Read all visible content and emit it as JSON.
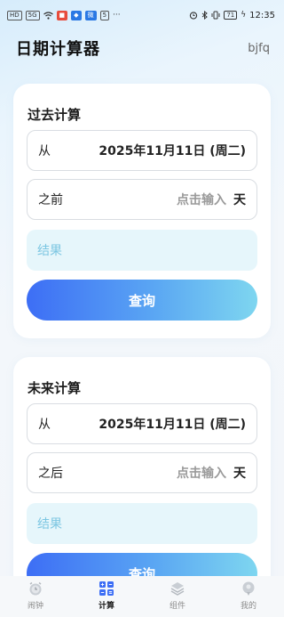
{
  "status_bar": {
    "left_chips": [
      "HD",
      "5G"
    ],
    "app_badges": [
      "微",
      "5"
    ],
    "battery": "71",
    "time": "12:35"
  },
  "header": {
    "title": "日期计算器",
    "right_link": "bjfq"
  },
  "past": {
    "title": "过去计算",
    "from_label": "从",
    "from_value": "2025年11月11日 (周二)",
    "days_label": "之前",
    "days_placeholder": "点击输入",
    "days_unit": "天",
    "result_label": "结果",
    "button_label": "查询"
  },
  "future": {
    "title": "未来计算",
    "from_label": "从",
    "from_value": "2025年11月11日 (周二)",
    "days_label": "之后",
    "days_placeholder": "点击输入",
    "days_unit": "天",
    "result_label": "结果",
    "button_label": "查询"
  },
  "tabs": [
    {
      "label": "闹钟",
      "icon": "clock-icon",
      "active": false
    },
    {
      "label": "计算",
      "icon": "grid-calculator-icon",
      "active": true
    },
    {
      "label": "组件",
      "icon": "layers-icon",
      "active": false
    },
    {
      "label": "我的",
      "icon": "profile-icon",
      "active": false
    }
  ],
  "colors": {
    "accent_start": "#3d6ef5",
    "accent_end": "#7ed6f0",
    "result_bg": "#e6f6fb",
    "result_text": "#7cc6e2"
  }
}
